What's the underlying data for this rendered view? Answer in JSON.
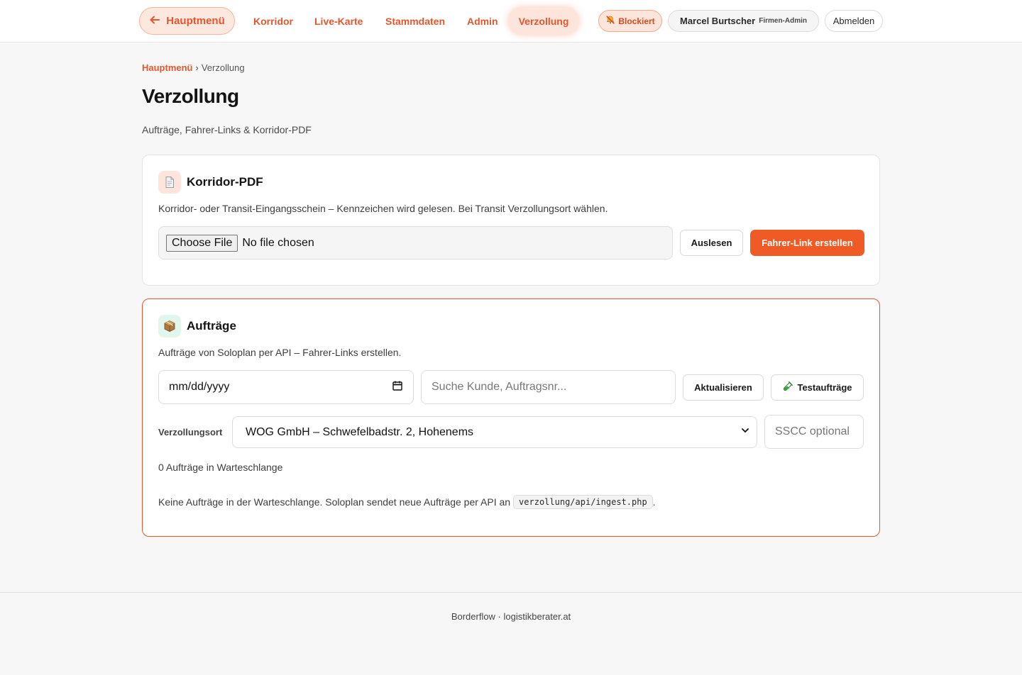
{
  "topbar": {
    "back_label": "Hauptmenü",
    "nav": [
      {
        "label": "Korridor"
      },
      {
        "label": "Live-Karte"
      },
      {
        "label": "Stammdaten"
      },
      {
        "label": "Admin"
      },
      {
        "label": "Verzollung",
        "active": true
      }
    ],
    "status_label": "Blockiert",
    "user_name": "Marcel Burtscher",
    "user_role": "Firmen-Admin",
    "logout_label": "Abmelden",
    "accent_color": "#e4572e"
  },
  "breadcrumb": {
    "root": "Hauptmenü",
    "separator": "›",
    "current": "Verzollung"
  },
  "page": {
    "title": "Verzollung",
    "subtitle": "Aufträge, Fahrer-Links & Korridor-PDF"
  },
  "pdf_card": {
    "icon": "document-icon",
    "title": "Korridor-PDF",
    "description": "Korridor- oder Transit-Eingangsschein – Kennzeichen wird gelesen. Bei Transit Verzollungsort wählen.",
    "file_button": "Choose File",
    "file_status": "No file chosen",
    "read_button": "Auslesen",
    "create_link_button": "Fahrer-Link erstellen"
  },
  "orders_card": {
    "icon": "package-icon",
    "title": "Aufträge",
    "description": "Aufträge von Soloplan per API – Fahrer-Links erstellen.",
    "date_placeholder": "mm/dd/yyyy",
    "search_placeholder": "Suche Kunde, Auftragsnr...",
    "refresh_button": "Aktualisieren",
    "test_button": "Testaufträge",
    "location_label": "Verzollungsort",
    "location_value": "WOG GmbH – Schwefelbadstr. 2, Hohenems",
    "sscc_placeholder": "SSCC optional",
    "queue_count": "0 Aufträge in Warteschlange",
    "empty_message": "Keine Aufträge in der Warteschlange. Soloplan sendet neue Aufträge per API an",
    "api_path": "verzollung/api/ingest.php",
    "empty_suffix": "."
  },
  "footer": {
    "text": "Borderflow · logistikberater.at"
  }
}
